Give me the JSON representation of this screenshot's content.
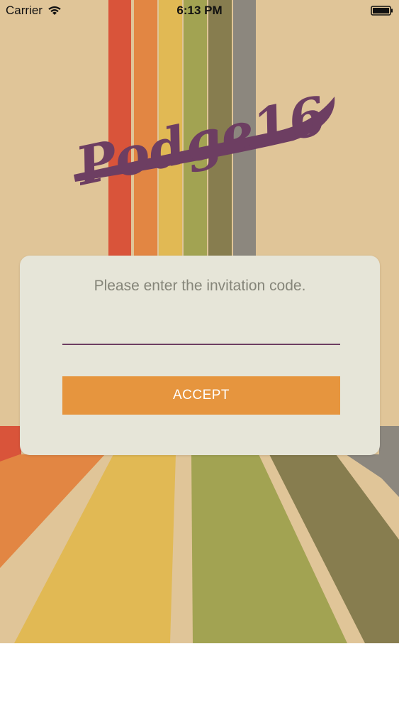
{
  "status_bar": {
    "carrier": "Carrier",
    "time": "6:13 PM"
  },
  "logo": {
    "text": "Podge16"
  },
  "card": {
    "prompt": "Please enter the invitation code.",
    "code_input": {
      "value": "",
      "placeholder": ""
    },
    "accept_label": "ACCEPT"
  },
  "colors": {
    "accent_purple": "#6d3e62",
    "button_orange": "#e6953e",
    "card_background": "#e6e5d8",
    "stripes": [
      "#e0553b",
      "#e98a45",
      "#e8bf57",
      "#a6a855",
      "#8a8052",
      "#8f8b83"
    ]
  }
}
